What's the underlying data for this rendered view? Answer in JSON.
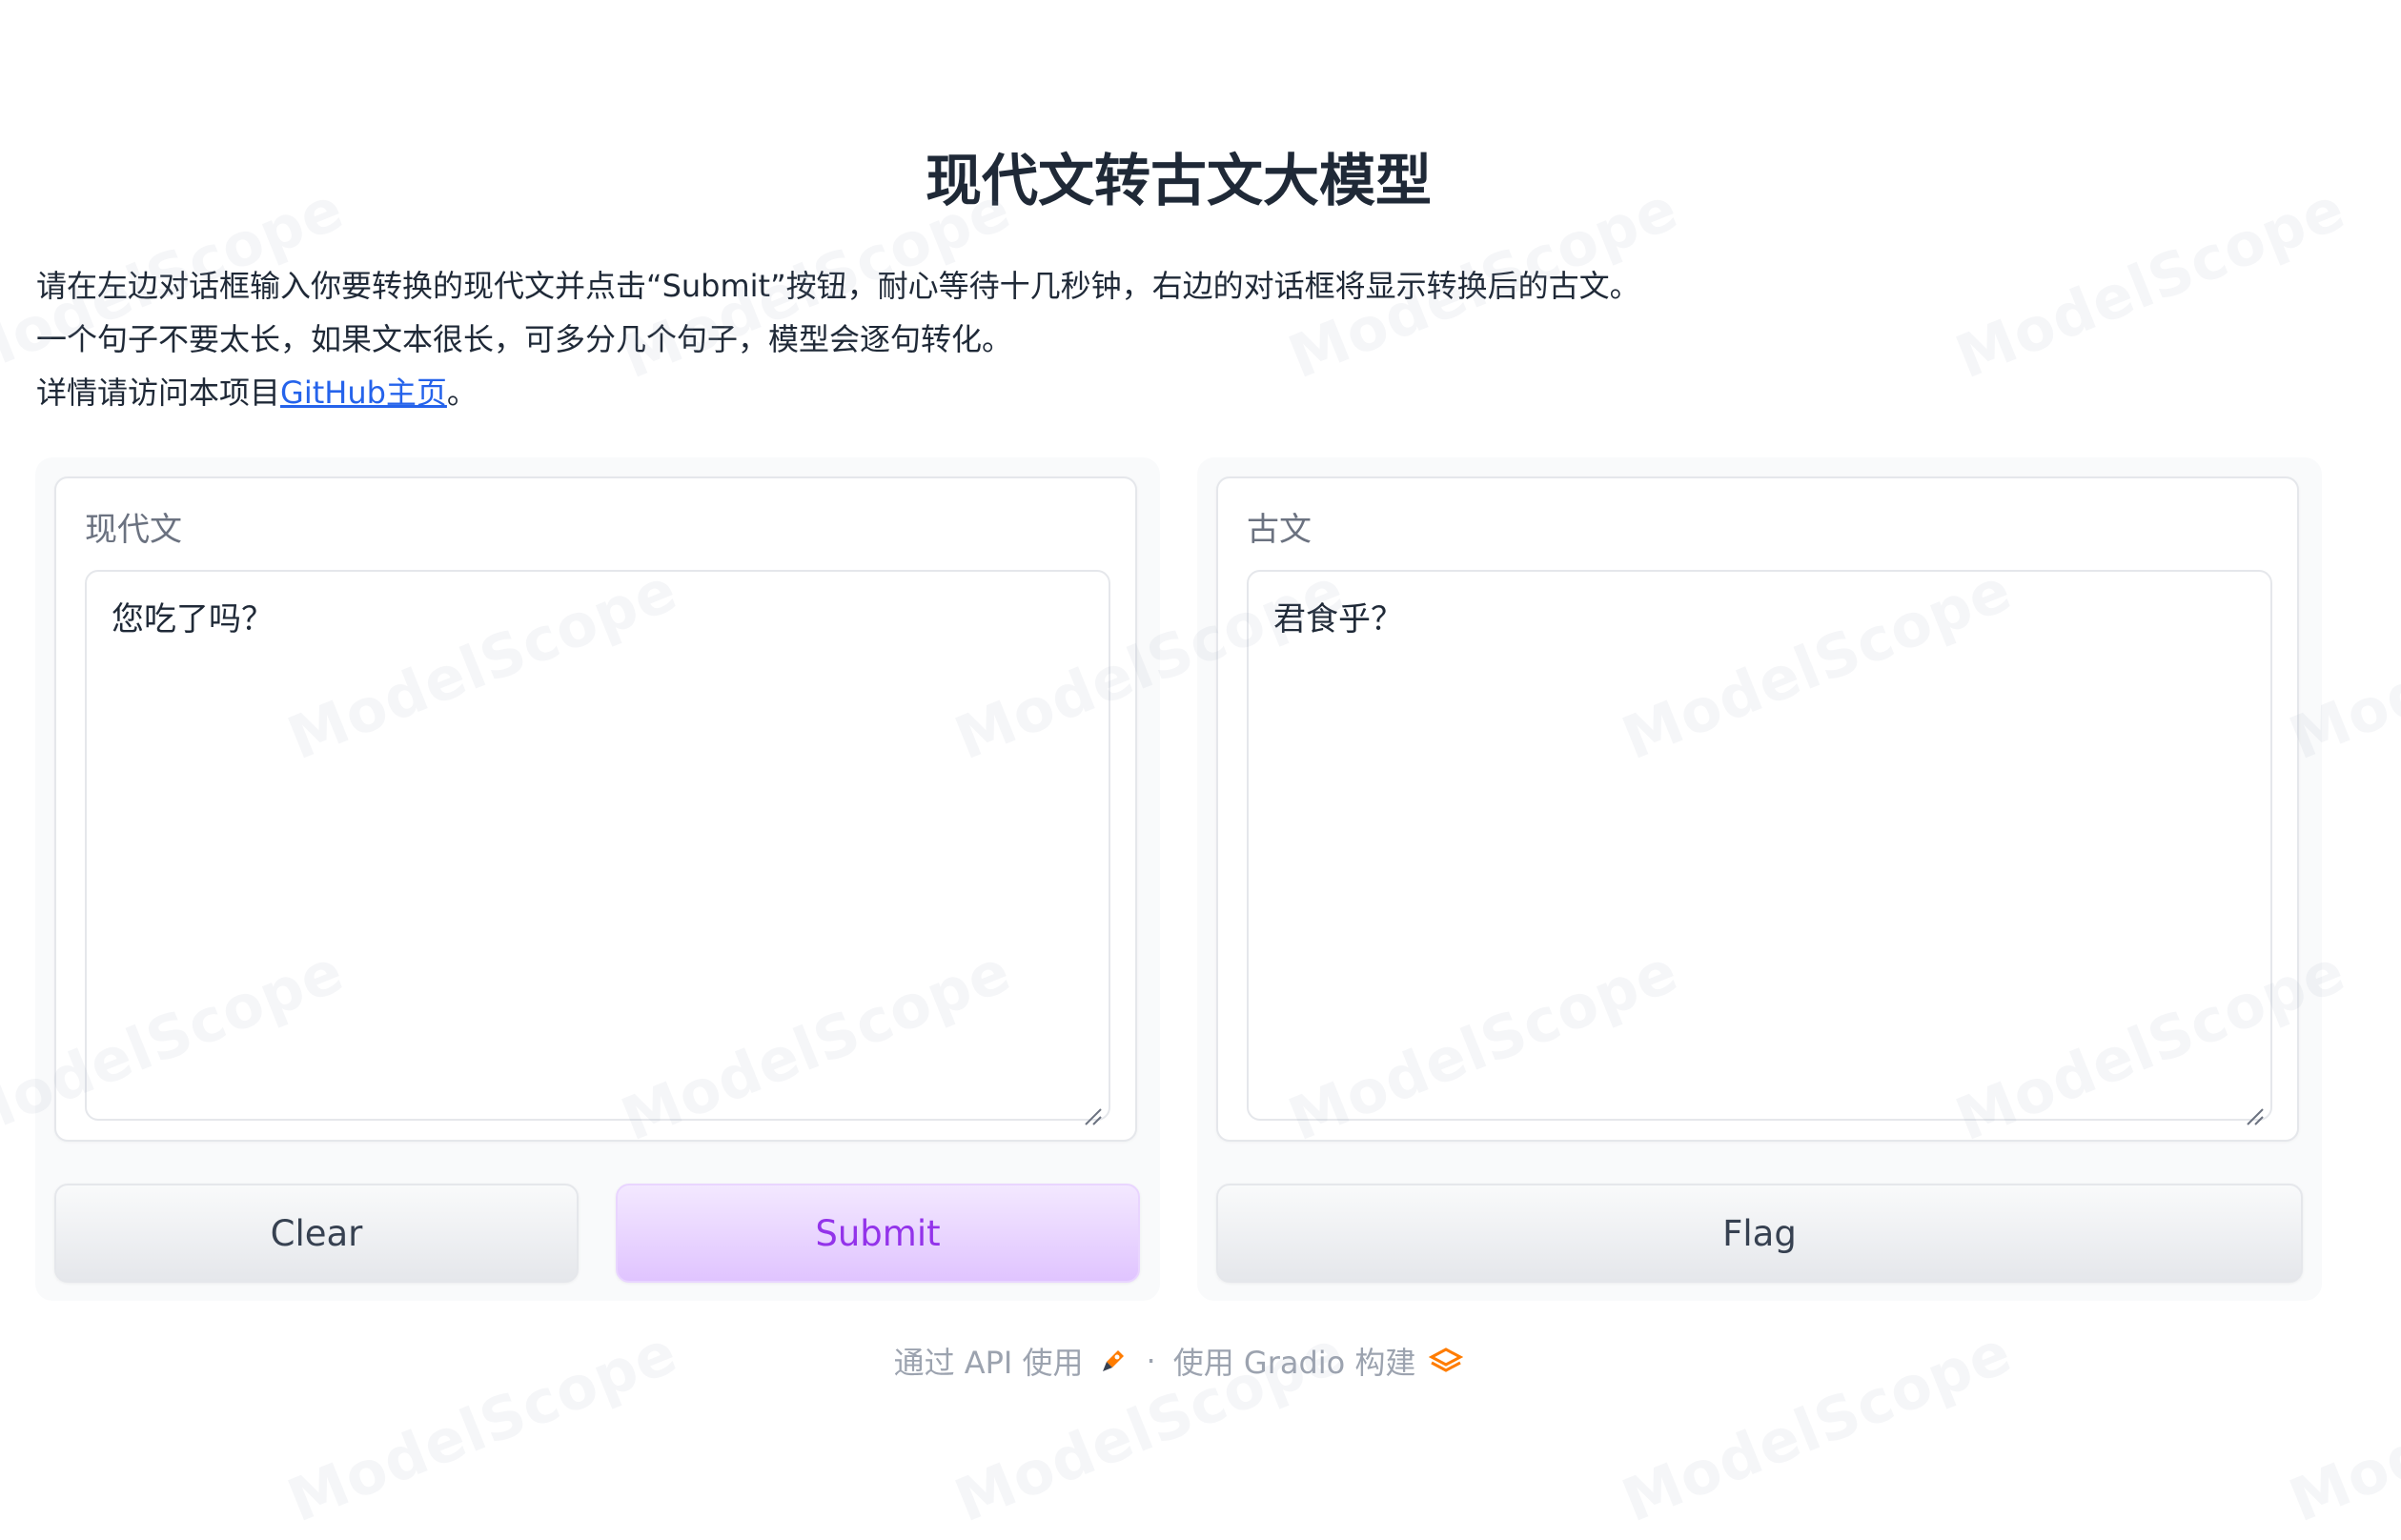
{
  "page": {
    "title": "现代文转古文大模型",
    "description_line1": "请在左边对话框输入你要转换的现代文并点击“Submit”按钮，耐心等待十几秒钟，右边的对话框将显示转换后的古文。",
    "description_line2": "一个句子不要太长，如果文本很长，可多分几个句子，模型会逐句转化。",
    "description_line3_prefix": "详情请访问本项目",
    "description_link_text": "GitHub主页",
    "description_line3_suffix": "。"
  },
  "input_panel": {
    "label": "现代文",
    "value": "您吃了吗？"
  },
  "output_panel": {
    "label": "古文",
    "value": "君食乎？"
  },
  "buttons": {
    "clear_label": "Clear",
    "submit_label": "Submit",
    "flag_label": "Flag"
  },
  "footer": {
    "api_text": "通过 API 使用",
    "separator": "·",
    "built_text": "使用 Gradio 构建"
  },
  "watermark": {
    "text": "ModelScope"
  },
  "colors": {
    "primary_text": "#9333ea",
    "primary_bg": "#e9d5ff",
    "link": "#2563eb",
    "footer_text": "#9ca3af"
  }
}
